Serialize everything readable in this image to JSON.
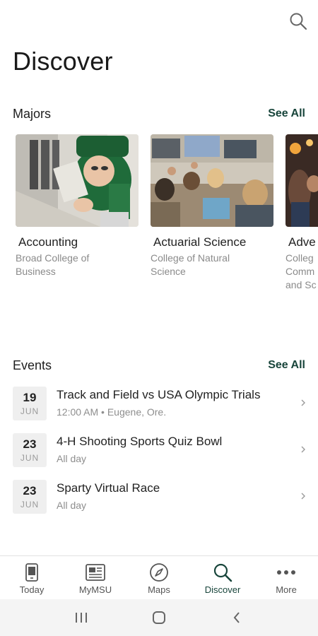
{
  "page": {
    "title": "Discover"
  },
  "icons": {
    "top_search": "search-icon"
  },
  "majors": {
    "section_title": "Majors",
    "see_all": "See All",
    "items": [
      {
        "name": "Accounting",
        "college": "Broad College of Business"
      },
      {
        "name": "Actuarial Science",
        "college": "College of Natural Science"
      },
      {
        "name": "Adve",
        "college": "Colleg Comm and Sc"
      }
    ]
  },
  "events": {
    "section_title": "Events",
    "see_all": "See All",
    "items": [
      {
        "day": "19",
        "month": "JUN",
        "title": "Track and Field vs USA Olympic Trials",
        "subtitle": "12:00 AM • Eugene, Ore."
      },
      {
        "day": "23",
        "month": "JUN",
        "title": "4-H Shooting Sports Quiz Bowl",
        "subtitle": "All day"
      },
      {
        "day": "23",
        "month": "JUN",
        "title": "Sparty Virtual Race",
        "subtitle": "All day"
      }
    ]
  },
  "bottom_nav": {
    "active": "Discover",
    "items": [
      {
        "label": "Today",
        "icon": "phone-icon"
      },
      {
        "label": "MyMSU",
        "icon": "newspaper-icon"
      },
      {
        "label": "Maps",
        "icon": "compass-icon"
      },
      {
        "label": "Discover",
        "icon": "search-icon"
      },
      {
        "label": "More",
        "icon": "more-dots-icon"
      }
    ]
  },
  "colors": {
    "accent": "#18453b",
    "text": "#222222",
    "muted": "#8a8a8a",
    "date_box": "#efefef"
  }
}
